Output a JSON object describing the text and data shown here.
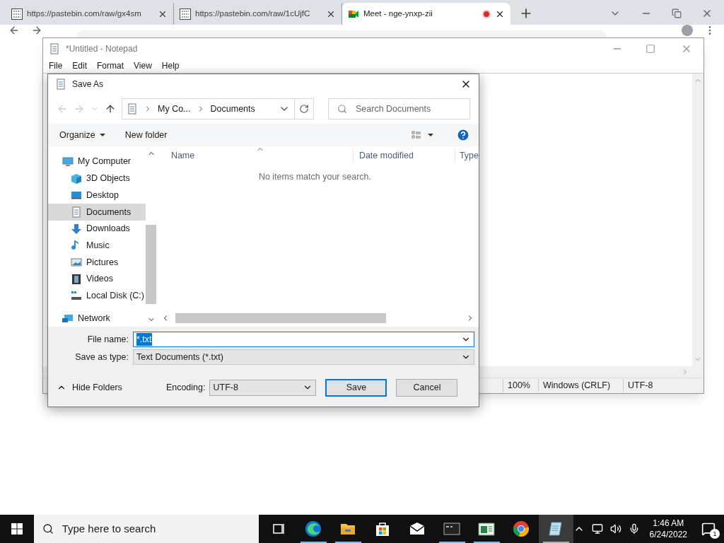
{
  "browser": {
    "tabs": [
      {
        "title": "https://pastebin.com/raw/gx4sm",
        "kind": "pastebin",
        "selected": false,
        "recording": false
      },
      {
        "title": "https://pastebin.com/raw/1cUjfC",
        "kind": "pastebin",
        "selected": false,
        "recording": false
      },
      {
        "title": "Meet - nge-ynxp-zii",
        "kind": "meet",
        "selected": true,
        "recording": true
      }
    ]
  },
  "notepad": {
    "title": "*Untitled - Notepad",
    "menu": [
      "File",
      "Edit",
      "Format",
      "View",
      "Help"
    ],
    "status": [
      "100%",
      "Windows (CRLF)",
      "UTF-8"
    ]
  },
  "dialog": {
    "title": "Save As",
    "path": [
      "My Co...",
      "Documents"
    ],
    "search": {
      "placeholder": "Search Documents"
    },
    "toolbar": [
      "Organize",
      "New folder"
    ],
    "tree": [
      {
        "label": "My Computer",
        "kind": "computer",
        "selected": false,
        "children": [
          {
            "label": "3D Objects",
            "kind": "cube",
            "selected": false
          },
          {
            "label": "Desktop",
            "kind": "desktop",
            "selected": false
          },
          {
            "label": "Documents",
            "kind": "documents",
            "selected": true
          },
          {
            "label": "Downloads",
            "kind": "downloads",
            "selected": false
          },
          {
            "label": "Music",
            "kind": "music",
            "selected": false
          },
          {
            "label": "Pictures",
            "kind": "pictures",
            "selected": false
          },
          {
            "label": "Videos",
            "kind": "videos",
            "selected": false
          },
          {
            "label": "Local Disk (C:)",
            "kind": "disk",
            "selected": false
          }
        ]
      },
      {
        "label": "Network",
        "kind": "network",
        "selected": false
      }
    ],
    "columns": [
      "Name",
      "Date modified",
      "Type"
    ],
    "empty_message": "No items match your search.",
    "file_name": {
      "label": "File name:",
      "value": "*.txt"
    },
    "save_as_type": {
      "label": "Save as type:",
      "value": "Text Documents (*.txt)"
    },
    "hide_folders": "Hide Folders",
    "encoding": {
      "label": "Encoding:",
      "value": "UTF-8"
    },
    "buttons": [
      "Save",
      "Cancel"
    ]
  },
  "taskbar": {
    "search_placeholder": "Type here to search",
    "apps": [
      {
        "kind": "taskview",
        "running": false,
        "selected": false
      },
      {
        "kind": "edge",
        "running": true,
        "selected": false
      },
      {
        "kind": "explorer",
        "running": true,
        "selected": false
      },
      {
        "kind": "store",
        "running": false,
        "selected": false
      },
      {
        "kind": "mail",
        "running": false,
        "selected": false
      },
      {
        "kind": "terminal",
        "running": true,
        "selected": false
      },
      {
        "kind": "reader",
        "running": true,
        "selected": false
      },
      {
        "kind": "chrome",
        "running": false,
        "selected": false
      },
      {
        "kind": "notepad",
        "running": true,
        "selected": true
      }
    ],
    "time": "1:46 AM",
    "date": "6/24/2022",
    "notifications": "1"
  }
}
